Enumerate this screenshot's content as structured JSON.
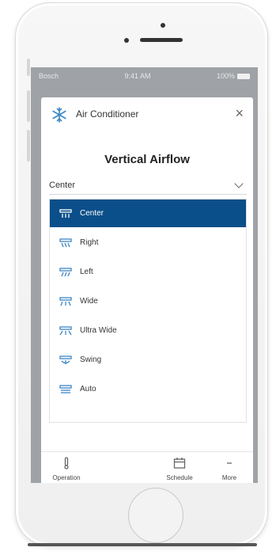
{
  "status": {
    "carrier": "Bosch",
    "time": "9:41 AM",
    "battery": "100%"
  },
  "dialog": {
    "app_title": "Air Conditioner",
    "close_label": "×",
    "heading": "Vertical Airflow",
    "selected_value": "Center",
    "options": [
      {
        "label": "Center",
        "selected": true
      },
      {
        "label": "Right",
        "selected": false
      },
      {
        "label": "Left",
        "selected": false
      },
      {
        "label": "Wide",
        "selected": false
      },
      {
        "label": "Ultra Wide",
        "selected": false
      },
      {
        "label": "Swing",
        "selected": false
      },
      {
        "label": "Auto",
        "selected": false
      }
    ]
  },
  "tabs": {
    "operation": "Operation",
    "schedule": "Schedule",
    "more": "More"
  },
  "colors": {
    "accent": "#0b4f8a",
    "icon_blue": "#3b86c6",
    "overlay": "#9fa3a7"
  },
  "icons": {
    "app": "snowflake-icon",
    "option": "airflow-vane-icon"
  }
}
